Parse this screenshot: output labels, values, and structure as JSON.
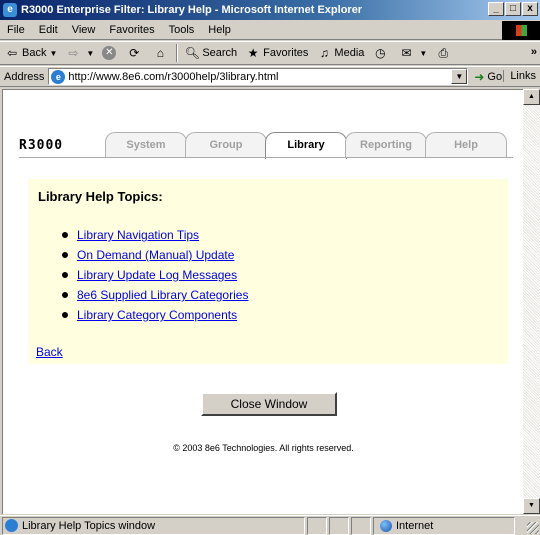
{
  "window": {
    "title": "R3000 Enterprise Filter: Library Help - Microsoft Internet Explorer",
    "app_icon": "ie-icon",
    "controls": {
      "minimize": "_",
      "maximize": "□",
      "close": "x"
    }
  },
  "menu": [
    "File",
    "Edit",
    "View",
    "Favorites",
    "Tools",
    "Help"
  ],
  "toolbar": {
    "back": "Back",
    "search": "Search",
    "favorites": "Favorites",
    "media": "Media",
    "more": "»"
  },
  "address_bar": {
    "label": "Address",
    "url": "http://www.8e6.com/r3000help/3library.html",
    "go": "Go",
    "links": "Links"
  },
  "page": {
    "brand": "R3000",
    "tabs": [
      {
        "label": "System",
        "active": false
      },
      {
        "label": "Group",
        "active": false
      },
      {
        "label": "Library",
        "active": true
      },
      {
        "label": "Reporting",
        "active": false
      },
      {
        "label": "Help",
        "active": false
      }
    ],
    "heading": "Library Help Topics:",
    "topics": [
      "Library Navigation Tips",
      "On Demand (Manual) Update",
      "Library Update Log Messages",
      "8e6 Supplied Library Categories",
      "Library Category Components"
    ],
    "back_link": "Back",
    "close_button": "Close Window",
    "copyright": "© 2003 8e6 Technologies. All rights reserved."
  },
  "status_bar": {
    "text": "Library Help Topics window",
    "zone": "Internet"
  },
  "colors": {
    "panel_bg": "#ffffe0",
    "link": "#0000ee",
    "titlebar": "#0a246a"
  }
}
